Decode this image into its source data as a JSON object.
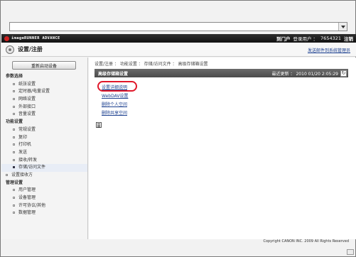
{
  "app": {
    "brand": "imageRUNNER ADVANCE",
    "portal_link": "到门户",
    "login_label": "登录用户 ：",
    "login_user": "7654321",
    "logout": "注销"
  },
  "title": {
    "text": "设置/注册",
    "admin_link": "发送邮件到系统管理员"
  },
  "sidebar": {
    "restart_label": "重新启动设备",
    "items": [
      {
        "label": "参数选择",
        "kind": "sec"
      },
      {
        "label": "纸张设置",
        "kind": "item"
      },
      {
        "label": "定时器/电量设置",
        "kind": "item"
      },
      {
        "label": "网络设置",
        "kind": "item"
      },
      {
        "label": "外部接口",
        "kind": "item"
      },
      {
        "label": "音量设置",
        "kind": "item"
      },
      {
        "label": "功能设置",
        "kind": "sec"
      },
      {
        "label": "常规设置",
        "kind": "item"
      },
      {
        "label": "复印",
        "kind": "item"
      },
      {
        "label": "打印机",
        "kind": "item"
      },
      {
        "label": "发送",
        "kind": "item"
      },
      {
        "label": "接收/转发",
        "kind": "item"
      },
      {
        "label": "存储/访问文件",
        "kind": "item",
        "active": true
      },
      {
        "label": "设置接收方",
        "kind": "sub"
      },
      {
        "label": "管理设置",
        "kind": "sec"
      },
      {
        "label": "用户管理",
        "kind": "item"
      },
      {
        "label": "设备管理",
        "kind": "item"
      },
      {
        "label": "许可协议/其他",
        "kind": "item"
      },
      {
        "label": "数据管理",
        "kind": "item"
      }
    ]
  },
  "main": {
    "breadcrumb": "设置/注册 ： 功能设置 ： 存储/访问文件 ： 高级存储箱设置",
    "panel_title": "高级存储箱设置",
    "last_updated": "最近更新 ： 2010 01/20 2:05:29",
    "links": [
      "设置详细说明",
      "WebDAV设置",
      "删除个人空间",
      "删除共享空间"
    ]
  },
  "footer": "Copyright CANON INC. 2009 All Rights Reserved",
  "colors": {
    "appbar": "#1a1a1a",
    "panel_head": "#5a5a5a",
    "link": "#1b3f8f",
    "highlight": "#e0182a"
  }
}
